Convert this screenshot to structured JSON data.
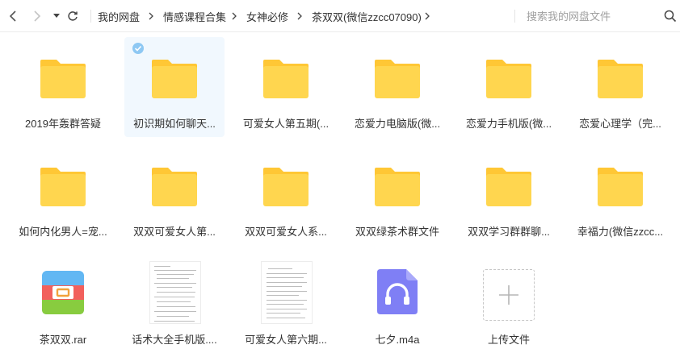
{
  "toolbar": {
    "back_icon": "chevron-left-icon",
    "forward_icon": "chevron-right-icon",
    "history_icon": "caret-down-icon",
    "refresh_icon": "refresh-icon",
    "breadcrumbs": [
      "我的网盘",
      "情感课程合集",
      "女神必修",
      "茶双双(微信zzcc07090)"
    ],
    "search_placeholder": "搜索我的网盘文件",
    "search_icon": "search-icon"
  },
  "items": [
    {
      "label": "2019年轰群答疑",
      "type": "folder"
    },
    {
      "label": "初识期如何聊天...",
      "type": "folder",
      "selected": true
    },
    {
      "label": "可爱女人第五期(...",
      "type": "folder"
    },
    {
      "label": "恋爱力电脑版(微...",
      "type": "folder"
    },
    {
      "label": "恋爱力手机版(微...",
      "type": "folder"
    },
    {
      "label": "恋爱心理学（完...",
      "type": "folder"
    },
    {
      "label": "如何内化男人=宠...",
      "type": "folder"
    },
    {
      "label": "双双可爱女人第...",
      "type": "folder"
    },
    {
      "label": "双双可爱女人系...",
      "type": "folder"
    },
    {
      "label": "双双绿茶术群文件",
      "type": "folder"
    },
    {
      "label": "双双学习群群聊...",
      "type": "folder"
    },
    {
      "label": "幸福力(微信zzcc...",
      "type": "folder"
    },
    {
      "label": "茶双双.rar",
      "type": "rar"
    },
    {
      "label": "话术大全手机版....",
      "type": "doc"
    },
    {
      "label": "可爱女人第六期...",
      "type": "doc"
    },
    {
      "label": "七夕.m4a",
      "type": "audio"
    },
    {
      "label": "上传文件",
      "type": "upload"
    }
  ],
  "colors": {
    "folder_body": "#ffd64f",
    "folder_tab": "#ffc735",
    "selected_bg": "#f1f8fe",
    "check": "#8ec8f3",
    "audio": "#7f7ff5"
  }
}
